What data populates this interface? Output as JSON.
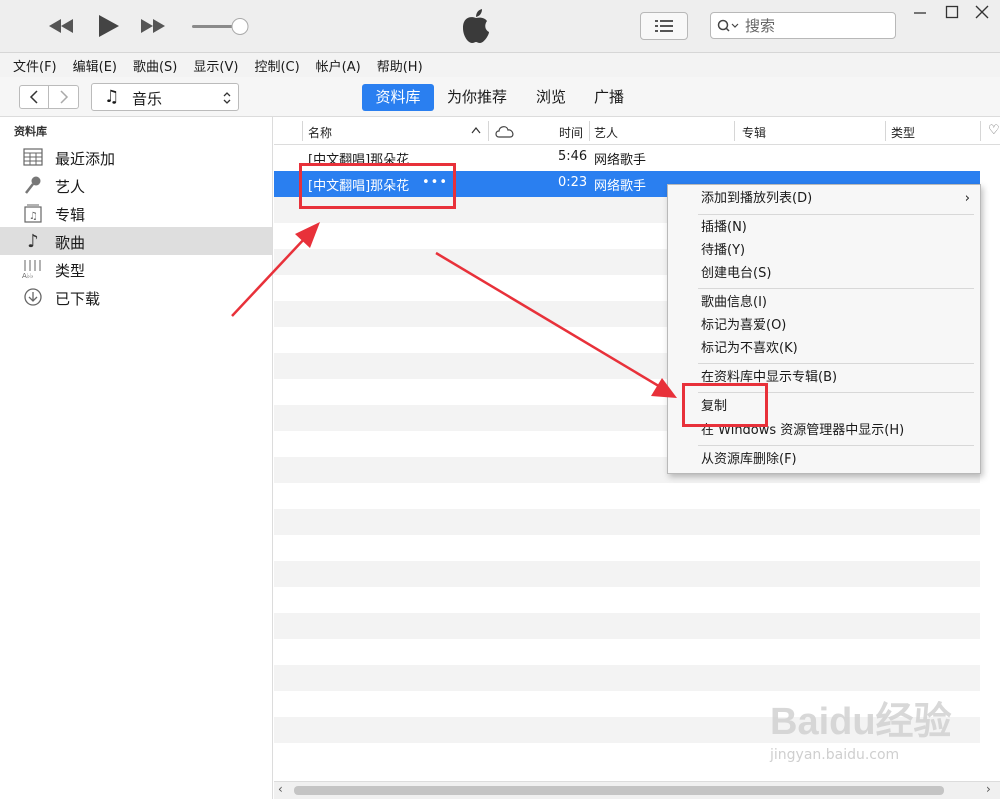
{
  "colors": {
    "accent": "#2a7ff0",
    "annotation": "#e8313a"
  },
  "toolbar": {
    "rewind_icon": "rewind-icon",
    "play_icon": "play-icon",
    "forward_icon": "fast-forward-icon",
    "list_icon": "list-icon",
    "search_placeholder": "搜索"
  },
  "menu": [
    "文件(F)",
    "编辑(E)",
    "歌曲(S)",
    "显示(V)",
    "控制(C)",
    "帐户(A)",
    "帮助(H)"
  ],
  "nav": {
    "media_select": "音乐",
    "tabs": [
      "资料库",
      "为你推荐",
      "浏览",
      "广播"
    ],
    "active_tab": "资料库"
  },
  "sidebar": {
    "heading": "资料库",
    "items": [
      {
        "label": "最近添加",
        "icon": "grid-icon"
      },
      {
        "label": "艺人",
        "icon": "microphone-icon"
      },
      {
        "label": "专辑",
        "icon": "album-icon"
      },
      {
        "label": "歌曲",
        "icon": "music-note-icon"
      },
      {
        "label": "类型",
        "icon": "genre-icon"
      },
      {
        "label": "已下载",
        "icon": "download-icon"
      }
    ],
    "active": "歌曲"
  },
  "table": {
    "columns": [
      "名称",
      "时间",
      "艺人",
      "专辑",
      "类型"
    ],
    "rows": [
      {
        "name": "[中文翻唱]那朵花",
        "time": "5:46",
        "artist": "网络歌手"
      },
      {
        "name": "[中文翻唱]那朵花",
        "more": "•••",
        "time": "0:23",
        "artist": "网络歌手"
      }
    ]
  },
  "context_menu": {
    "items": [
      "添加到播放列表(D)",
      "插播(N)",
      "待播(Y)",
      "创建电台(S)",
      "歌曲信息(I)",
      "标记为喜爱(O)",
      "标记为不喜欢(K)",
      "在资料库中显示专辑(B)",
      "复制",
      "在 Windows 资源管理器中显示(H)",
      "从资源库删除(F)"
    ],
    "submenu_arrow": "›"
  },
  "watermark": {
    "brand": "Baidu经验",
    "url": "jingyan.baidu.com"
  }
}
